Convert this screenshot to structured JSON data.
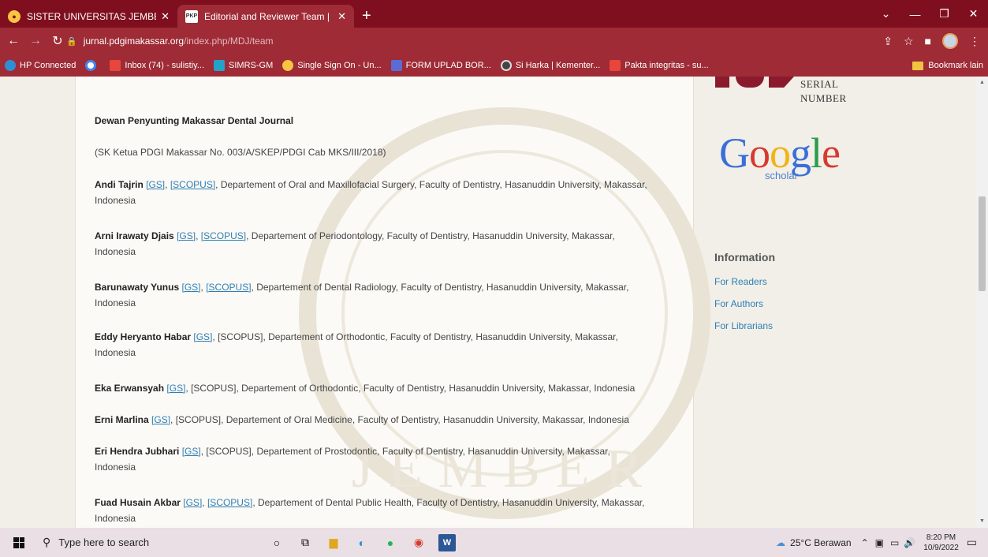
{
  "browser": {
    "tabs": [
      {
        "label": "SISTER UNIVERSITAS JEMBER",
        "active": false
      },
      {
        "label": "Editorial and Reviewer Team | Ma",
        "active": true
      }
    ],
    "url_host": "jurnal.pdgimakassar.org",
    "url_path": "/index.php/MDJ/team",
    "bookmarks": [
      "HP Connected",
      "",
      "Inbox (74) - sulistiy...",
      "SIMRS-GM",
      "Single Sign On - Un...",
      "FORM UPLAD BOR...",
      "Si Harka | Kementer...",
      "Pakta integritas - su..."
    ],
    "bookmark_folder": "Bookmark lain"
  },
  "page": {
    "heading": "Dewan Penyunting Makassar Dental Journal",
    "sk": "(SK Ketua PDGI Makassar No. 003/A/SKEP/PDGI Cab MKS/III/2018)",
    "gs_label": "[GS]",
    "scopus_label": "[SCOPUS]",
    "members": [
      {
        "name": "Andi Tajrin",
        "scopus_link": true,
        "desc": "Departement of Oral and Maxillofacial Surgery, Faculty of Dentistry, Hasanuddin University, Makassar,",
        "desc2": "Indonesia"
      },
      {
        "name": "Arni Irawaty Djais",
        "scopus_link": true,
        "desc": "Departement of Periodontology, Faculty of Dentistry, Hasanuddin University, Makassar,",
        "desc2": "Indonesia"
      },
      {
        "name": "Barunawaty Yunus",
        "scopus_link": true,
        "desc": "Departement of Dental Radiology, Faculty of Dentistry, Hasanuddin University, Makassar,",
        "desc2": "Indonesia"
      },
      {
        "name": "Eddy Heryanto Habar",
        "scopus_link": false,
        "desc": "Departement of Orthodontic, Faculty of Dentistry, Hasanuddin University, Makassar,",
        "desc2": "Indonesia"
      },
      {
        "name": "Eka Erwansyah",
        "scopus_link": false,
        "desc": "Departement of Orthodontic, Faculty of Dentistry, Hasanuddin University, Makassar, Indonesia",
        "desc2": ""
      },
      {
        "name": "Erni Marlina",
        "scopus_link": false,
        "desc": "Departement of Oral Medicine, Faculty of Dentistry, Hasanuddin University, Makassar, Indonesia",
        "desc2": ""
      },
      {
        "name": "Eri Hendra Jubhari",
        "scopus_link": false,
        "desc": "Departement of Prostodontic, Faculty of Dentistry, Hasanuddin University, Makassar,",
        "desc2": "Indonesia"
      },
      {
        "name": "Fuad Husain Akbar",
        "scopus_link": true,
        "desc": "Departement of Dental Public Health, Faculty of Dentistry, Hasanuddin University, Makassar,",
        "desc2": "Indonesia"
      }
    ]
  },
  "sidebar": {
    "issn_line1": "SERIAL",
    "issn_line2": "NUMBER",
    "google_word": "Google",
    "scholar_word": "scholar",
    "info_heading": "Information",
    "links": [
      "For Readers",
      "For Authors",
      "For Librarians"
    ]
  },
  "taskbar": {
    "search_placeholder": "Type here to search",
    "weather": "25°C  Berawan",
    "time": "8:20 PM",
    "date": "10/9/2022"
  },
  "colors": {
    "chrome": "#7f0f1f",
    "chrome_active": "#9e2b35",
    "link": "#2f7fb5",
    "brand_red": "#8b1a2d"
  }
}
